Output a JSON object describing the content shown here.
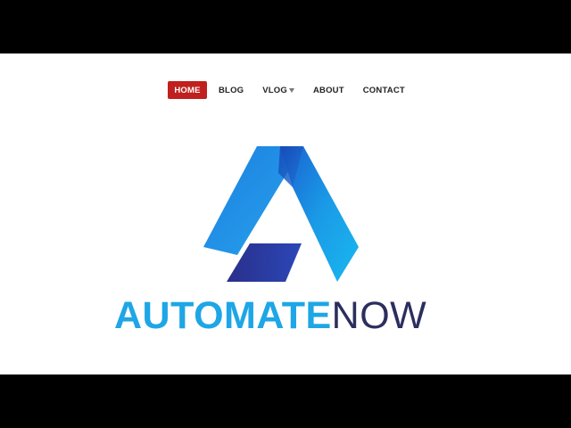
{
  "nav": {
    "items": [
      {
        "label": "HOME",
        "active": true
      },
      {
        "label": "BLOG",
        "active": false
      },
      {
        "label": "VLOG",
        "active": false,
        "has_dropdown": true
      },
      {
        "label": "ABOUT",
        "active": false
      },
      {
        "label": "CONTACT",
        "active": false
      }
    ],
    "active_color": "#c0201e"
  },
  "brand": {
    "word_primary": "AUTOMATE",
    "word_secondary": "NOW",
    "primary_color": "#1ea6e6",
    "secondary_color": "#2c2e5e",
    "logo_icon": "automatenow-a-logo-icon"
  }
}
